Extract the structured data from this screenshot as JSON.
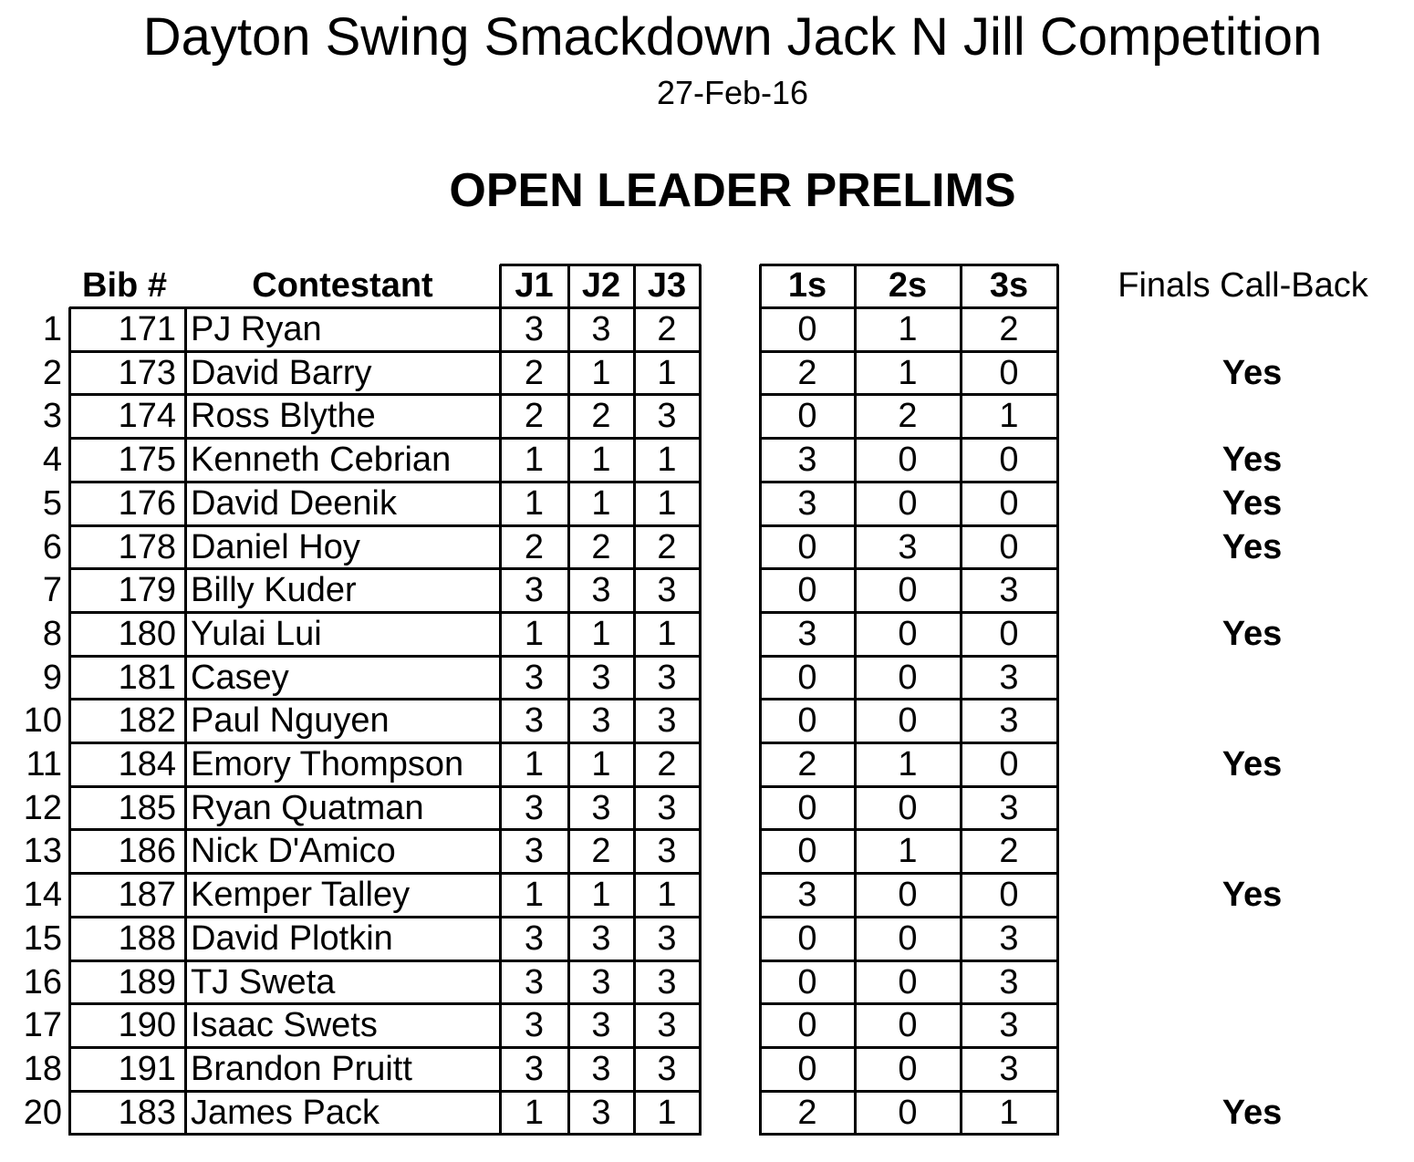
{
  "header": {
    "title": "Dayton Swing Smackdown Jack N Jill Competition",
    "date": "27-Feb-16",
    "section": "OPEN LEADER PRELIMS"
  },
  "columns": {
    "bib": "Bib #",
    "contestant": "Contestant",
    "j1": "J1",
    "j2": "J2",
    "j3": "J3",
    "ones": "1s",
    "twos": "2s",
    "threes": "3s",
    "callback": "Finals Call-Back"
  },
  "rows": [
    {
      "num": "1",
      "bib": "171",
      "name": "PJ Ryan",
      "j1": "3",
      "j2": "3",
      "j3": "2",
      "s1": "0",
      "s2": "1",
      "s3": "2",
      "callback": ""
    },
    {
      "num": "2",
      "bib": "173",
      "name": "David Barry",
      "j1": "2",
      "j2": "1",
      "j3": "1",
      "s1": "2",
      "s2": "1",
      "s3": "0",
      "callback": "Yes"
    },
    {
      "num": "3",
      "bib": "174",
      "name": "Ross Blythe",
      "j1": "2",
      "j2": "2",
      "j3": "3",
      "s1": "0",
      "s2": "2",
      "s3": "1",
      "callback": ""
    },
    {
      "num": "4",
      "bib": "175",
      "name": "Kenneth Cebrian",
      "j1": "1",
      "j2": "1",
      "j3": "1",
      "s1": "3",
      "s2": "0",
      "s3": "0",
      "callback": "Yes"
    },
    {
      "num": "5",
      "bib": "176",
      "name": "David Deenik",
      "j1": "1",
      "j2": "1",
      "j3": "1",
      "s1": "3",
      "s2": "0",
      "s3": "0",
      "callback": "Yes"
    },
    {
      "num": "6",
      "bib": "178",
      "name": "Daniel Hoy",
      "j1": "2",
      "j2": "2",
      "j3": "2",
      "s1": "0",
      "s2": "3",
      "s3": "0",
      "callback": "Yes"
    },
    {
      "num": "7",
      "bib": "179",
      "name": "Billy Kuder",
      "j1": "3",
      "j2": "3",
      "j3": "3",
      "s1": "0",
      "s2": "0",
      "s3": "3",
      "callback": ""
    },
    {
      "num": "8",
      "bib": "180",
      "name": "Yulai Lui",
      "j1": "1",
      "j2": "1",
      "j3": "1",
      "s1": "3",
      "s2": "0",
      "s3": "0",
      "callback": "Yes"
    },
    {
      "num": "9",
      "bib": "181",
      "name": "Casey",
      "j1": "3",
      "j2": "3",
      "j3": "3",
      "s1": "0",
      "s2": "0",
      "s3": "3",
      "callback": ""
    },
    {
      "num": "10",
      "bib": "182",
      "name": "Paul Nguyen",
      "j1": "3",
      "j2": "3",
      "j3": "3",
      "s1": "0",
      "s2": "0",
      "s3": "3",
      "callback": ""
    },
    {
      "num": "11",
      "bib": "184",
      "name": "Emory Thompson",
      "j1": "1",
      "j2": "1",
      "j3": "2",
      "s1": "2",
      "s2": "1",
      "s3": "0",
      "callback": "Yes"
    },
    {
      "num": "12",
      "bib": "185",
      "name": "Ryan Quatman",
      "j1": "3",
      "j2": "3",
      "j3": "3",
      "s1": "0",
      "s2": "0",
      "s3": "3",
      "callback": ""
    },
    {
      "num": "13",
      "bib": "186",
      "name": "Nick D'Amico",
      "j1": "3",
      "j2": "2",
      "j3": "3",
      "s1": "0",
      "s2": "1",
      "s3": "2",
      "callback": ""
    },
    {
      "num": "14",
      "bib": "187",
      "name": "Kemper Talley",
      "j1": "1",
      "j2": "1",
      "j3": "1",
      "s1": "3",
      "s2": "0",
      "s3": "0",
      "callback": "Yes"
    },
    {
      "num": "15",
      "bib": "188",
      "name": "David Plotkin",
      "j1": "3",
      "j2": "3",
      "j3": "3",
      "s1": "0",
      "s2": "0",
      "s3": "3",
      "callback": ""
    },
    {
      "num": "16",
      "bib": "189",
      "name": "TJ Sweta",
      "j1": "3",
      "j2": "3",
      "j3": "3",
      "s1": "0",
      "s2": "0",
      "s3": "3",
      "callback": ""
    },
    {
      "num": "17",
      "bib": "190",
      "name": "Isaac Swets",
      "j1": "3",
      "j2": "3",
      "j3": "3",
      "s1": "0",
      "s2": "0",
      "s3": "3",
      "callback": ""
    },
    {
      "num": "18",
      "bib": "191",
      "name": "Brandon Pruitt",
      "j1": "3",
      "j2": "3",
      "j3": "3",
      "s1": "0",
      "s2": "0",
      "s3": "3",
      "callback": ""
    },
    {
      "num": "20",
      "bib": "183",
      "name": "James Pack",
      "j1": "1",
      "j2": "3",
      "j3": "1",
      "s1": "2",
      "s2": "0",
      "s3": "1",
      "callback": "Yes"
    }
  ]
}
